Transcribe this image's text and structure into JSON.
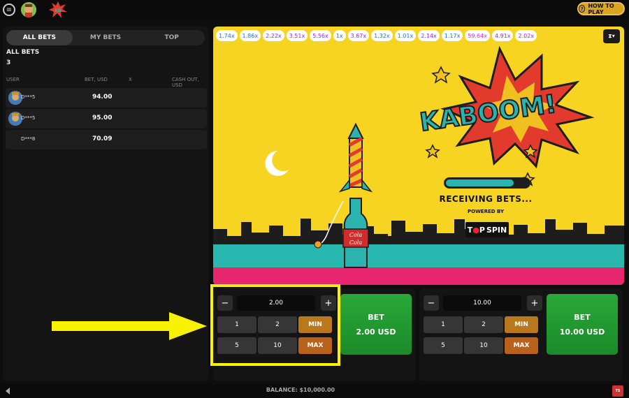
{
  "topbar": {
    "how_to_play": "HOW TO PLAY"
  },
  "left_panel": {
    "tabs": [
      "ALL BETS",
      "MY BETS",
      "TOP"
    ],
    "all_bets_title": "ALL BETS",
    "all_bets_count": "3",
    "columns": [
      "USER",
      "BET, USD",
      "X",
      "CASH OUT, USD"
    ],
    "rows": [
      {
        "user": "D***5",
        "bet": "94.00"
      },
      {
        "user": "D***5",
        "bet": "95.00"
      },
      {
        "user": "D***8",
        "bet": "70.09"
      }
    ]
  },
  "game": {
    "coefficients": [
      "1.74x",
      "1.86x",
      "2.22x",
      "3.51x",
      "5.56x",
      "1x",
      "3.67x",
      "1.32x",
      "1.01x",
      "2.14x",
      "1.17x",
      "59.64x",
      "4.91x",
      "2.02x"
    ],
    "coef_colors": [
      "#2a6fd6",
      "#2a6fd6",
      "#a02ad6",
      "#a02ad6",
      "#a02ad6",
      "#2a6fd6",
      "#a02ad6",
      "#2a6fd6",
      "#2a6fd6",
      "#a02ad6",
      "#2a6fd6",
      "#e02ad6",
      "#a02ad6",
      "#a02ad6"
    ],
    "kaboom": "KABOOM!",
    "progress": 0.82,
    "status": "RECEIVING BETS...",
    "powered_by": "POWERED BY",
    "brand_1": "T",
    "brand_2": "P",
    "brand_3": "SPIN",
    "bottle_label_1": "Cola",
    "bottle_label_2": "Cola"
  },
  "bet_panels": [
    {
      "amount": "2.00",
      "quick": [
        "1",
        "2",
        "MIN",
        "5",
        "10",
        "MAX"
      ],
      "bet_label": "BET",
      "bet_amount": "2.00 USD"
    },
    {
      "amount": "10.00",
      "quick": [
        "1",
        "2",
        "MIN",
        "5",
        "10",
        "MAX"
      ],
      "bet_label": "BET",
      "bet_amount": "10.00 USD"
    }
  ],
  "footer": {
    "balance": "BALANCE: $10,000.00"
  },
  "colors": {
    "game_bg": "#f6d421",
    "accent": "#d9a41f",
    "bet_green": "#2aa838",
    "highlight": "#f8f200"
  }
}
